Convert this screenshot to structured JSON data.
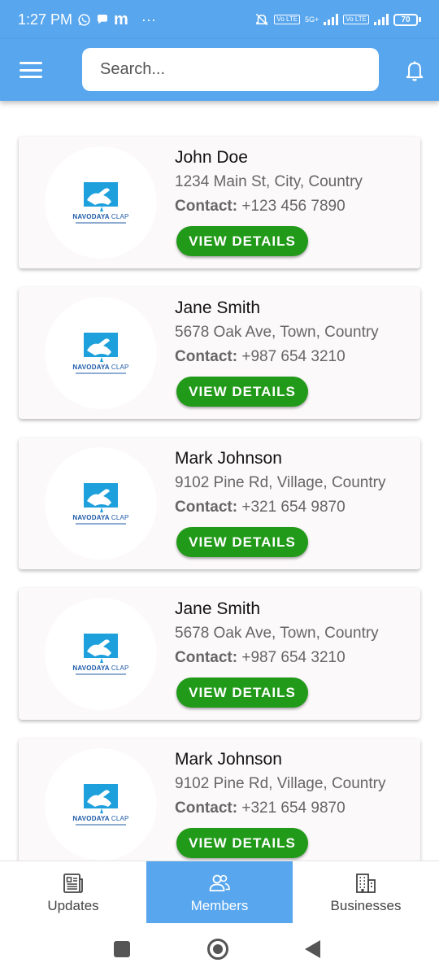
{
  "status_bar": {
    "time": "1:27 PM",
    "app_icons": [
      "whatsapp-icon",
      "chat-icon",
      "m-icon"
    ],
    "app_icon_m": "m",
    "more": "···",
    "net_label": "5G+",
    "lte_label": "Vo LTE",
    "battery": "70"
  },
  "app_bar": {
    "search_placeholder": "Search...",
    "color": "#58a6ee"
  },
  "logo": {
    "brand": "NAVODAYA",
    "brand_suffix": "CLAP"
  },
  "members": [
    {
      "name": "John Doe",
      "address": "1234 Main St, City, Country",
      "contact_label": "Contact:",
      "contact": "+123 456 7890",
      "button": "VIEW DETAILS"
    },
    {
      "name": "Jane Smith",
      "address": "5678 Oak Ave, Town, Country",
      "contact_label": "Contact:",
      "contact": "+987 654 3210",
      "button": "VIEW DETAILS"
    },
    {
      "name": "Mark Johnson",
      "address": "9102 Pine Rd, Village, Country",
      "contact_label": "Contact:",
      "contact": "+321 654 9870",
      "button": "VIEW DETAILS"
    },
    {
      "name": "Jane Smith",
      "address": "5678 Oak Ave, Town, Country",
      "contact_label": "Contact:",
      "contact": "+987 654 3210",
      "button": "VIEW DETAILS"
    },
    {
      "name": "Mark Johnson",
      "address": "9102 Pine Rd, Village, Country",
      "contact_label": "Contact:",
      "contact": "+321 654 9870",
      "button": "VIEW DETAILS"
    }
  ],
  "bottom_nav": [
    {
      "label": "Updates",
      "icon": "newspaper-icon",
      "active": false
    },
    {
      "label": "Members",
      "icon": "people-icon",
      "active": true
    },
    {
      "label": "Businesses",
      "icon": "building-icon",
      "active": false
    }
  ],
  "colors": {
    "primary": "#58a6ee",
    "button": "#219a19",
    "logo": "#1f5aa8",
    "logo_mark": "#1ea0dc"
  }
}
